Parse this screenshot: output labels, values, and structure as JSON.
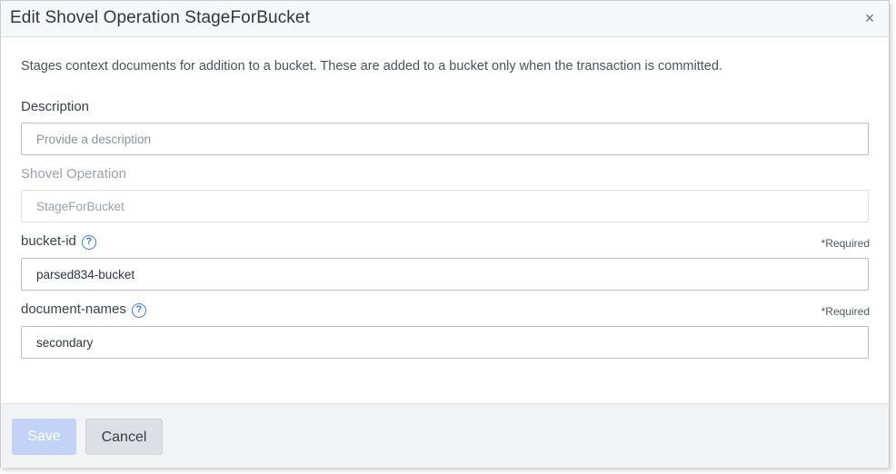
{
  "modal": {
    "title": "Edit Shovel Operation StageForBucket",
    "close_glyph": "×",
    "close_icon": "close-icon"
  },
  "body": {
    "intro": "Stages context documents for addition to a bucket. These are added to a bucket only when the transaction is committed.",
    "description": {
      "label": "Description",
      "placeholder": "Provide a description",
      "value": ""
    },
    "shovel_operation": {
      "label": "Shovel Operation",
      "value": "StageForBucket",
      "disabled": true
    },
    "bucket_id": {
      "label": "bucket-id",
      "help_glyph": "?",
      "required": "*Required",
      "value": "parsed834-bucket"
    },
    "document_names": {
      "label": "document-names",
      "help_glyph": "?",
      "required": "*Required",
      "value": "secondary"
    }
  },
  "footer": {
    "save_label": "Save",
    "save_disabled": true,
    "cancel_label": "Cancel"
  },
  "colors": {
    "accent": "#3a7be0",
    "save_disabled_bg": "#c3d3f7",
    "cancel_bg": "#dcdfe3"
  }
}
